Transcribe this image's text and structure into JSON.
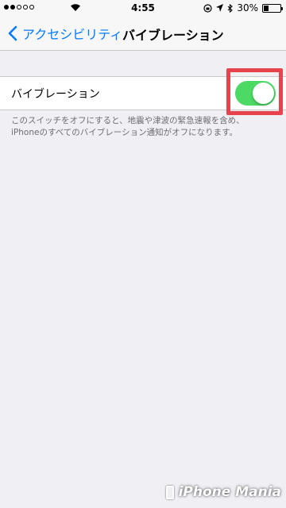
{
  "status_bar": {
    "time": "4:55",
    "battery": "30%",
    "battery_level": 0.3,
    "signal_filled": 2,
    "signal_total": 5
  },
  "nav": {
    "back_label": "アクセシビリティ",
    "title": "バイブレーション"
  },
  "setting": {
    "label": "バイブレーション",
    "toggle_on": true
  },
  "footer": {
    "line1": "このスイッチをオフにすると、地震や津波の緊急速報を含め、",
    "line2": "iPhoneのすべてのバイブレーション通知がオフになります。"
  },
  "watermark": {
    "text": "iPhone Mania"
  },
  "colors": {
    "accent": "#007aff",
    "toggle_on": "#4cd964",
    "highlight": "#e6434d",
    "background": "#efeff4"
  }
}
